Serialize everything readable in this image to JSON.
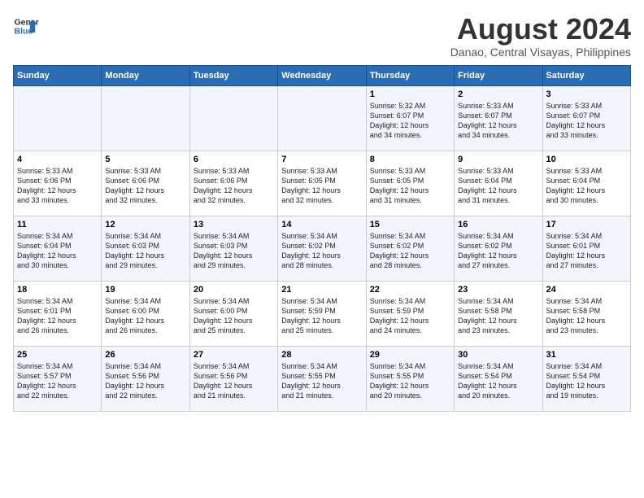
{
  "logo": {
    "text_general": "General",
    "text_blue": "Blue"
  },
  "title": "August 2024",
  "subtitle": "Danao, Central Visayas, Philippines",
  "weekdays": [
    "Sunday",
    "Monday",
    "Tuesday",
    "Wednesday",
    "Thursday",
    "Friday",
    "Saturday"
  ],
  "weeks": [
    [
      {
        "day": "",
        "info": ""
      },
      {
        "day": "",
        "info": ""
      },
      {
        "day": "",
        "info": ""
      },
      {
        "day": "",
        "info": ""
      },
      {
        "day": "1",
        "info": "Sunrise: 5:32 AM\nSunset: 6:07 PM\nDaylight: 12 hours\nand 34 minutes."
      },
      {
        "day": "2",
        "info": "Sunrise: 5:33 AM\nSunset: 6:07 PM\nDaylight: 12 hours\nand 34 minutes."
      },
      {
        "day": "3",
        "info": "Sunrise: 5:33 AM\nSunset: 6:07 PM\nDaylight: 12 hours\nand 33 minutes."
      }
    ],
    [
      {
        "day": "4",
        "info": "Sunrise: 5:33 AM\nSunset: 6:06 PM\nDaylight: 12 hours\nand 33 minutes."
      },
      {
        "day": "5",
        "info": "Sunrise: 5:33 AM\nSunset: 6:06 PM\nDaylight: 12 hours\nand 32 minutes."
      },
      {
        "day": "6",
        "info": "Sunrise: 5:33 AM\nSunset: 6:06 PM\nDaylight: 12 hours\nand 32 minutes."
      },
      {
        "day": "7",
        "info": "Sunrise: 5:33 AM\nSunset: 6:05 PM\nDaylight: 12 hours\nand 32 minutes."
      },
      {
        "day": "8",
        "info": "Sunrise: 5:33 AM\nSunset: 6:05 PM\nDaylight: 12 hours\nand 31 minutes."
      },
      {
        "day": "9",
        "info": "Sunrise: 5:33 AM\nSunset: 6:04 PM\nDaylight: 12 hours\nand 31 minutes."
      },
      {
        "day": "10",
        "info": "Sunrise: 5:33 AM\nSunset: 6:04 PM\nDaylight: 12 hours\nand 30 minutes."
      }
    ],
    [
      {
        "day": "11",
        "info": "Sunrise: 5:34 AM\nSunset: 6:04 PM\nDaylight: 12 hours\nand 30 minutes."
      },
      {
        "day": "12",
        "info": "Sunrise: 5:34 AM\nSunset: 6:03 PM\nDaylight: 12 hours\nand 29 minutes."
      },
      {
        "day": "13",
        "info": "Sunrise: 5:34 AM\nSunset: 6:03 PM\nDaylight: 12 hours\nand 29 minutes."
      },
      {
        "day": "14",
        "info": "Sunrise: 5:34 AM\nSunset: 6:02 PM\nDaylight: 12 hours\nand 28 minutes."
      },
      {
        "day": "15",
        "info": "Sunrise: 5:34 AM\nSunset: 6:02 PM\nDaylight: 12 hours\nand 28 minutes."
      },
      {
        "day": "16",
        "info": "Sunrise: 5:34 AM\nSunset: 6:02 PM\nDaylight: 12 hours\nand 27 minutes."
      },
      {
        "day": "17",
        "info": "Sunrise: 5:34 AM\nSunset: 6:01 PM\nDaylight: 12 hours\nand 27 minutes."
      }
    ],
    [
      {
        "day": "18",
        "info": "Sunrise: 5:34 AM\nSunset: 6:01 PM\nDaylight: 12 hours\nand 26 minutes."
      },
      {
        "day": "19",
        "info": "Sunrise: 5:34 AM\nSunset: 6:00 PM\nDaylight: 12 hours\nand 26 minutes."
      },
      {
        "day": "20",
        "info": "Sunrise: 5:34 AM\nSunset: 6:00 PM\nDaylight: 12 hours\nand 25 minutes."
      },
      {
        "day": "21",
        "info": "Sunrise: 5:34 AM\nSunset: 5:59 PM\nDaylight: 12 hours\nand 25 minutes."
      },
      {
        "day": "22",
        "info": "Sunrise: 5:34 AM\nSunset: 5:59 PM\nDaylight: 12 hours\nand 24 minutes."
      },
      {
        "day": "23",
        "info": "Sunrise: 5:34 AM\nSunset: 5:58 PM\nDaylight: 12 hours\nand 23 minutes."
      },
      {
        "day": "24",
        "info": "Sunrise: 5:34 AM\nSunset: 5:58 PM\nDaylight: 12 hours\nand 23 minutes."
      }
    ],
    [
      {
        "day": "25",
        "info": "Sunrise: 5:34 AM\nSunset: 5:57 PM\nDaylight: 12 hours\nand 22 minutes."
      },
      {
        "day": "26",
        "info": "Sunrise: 5:34 AM\nSunset: 5:56 PM\nDaylight: 12 hours\nand 22 minutes."
      },
      {
        "day": "27",
        "info": "Sunrise: 5:34 AM\nSunset: 5:56 PM\nDaylight: 12 hours\nand 21 minutes."
      },
      {
        "day": "28",
        "info": "Sunrise: 5:34 AM\nSunset: 5:55 PM\nDaylight: 12 hours\nand 21 minutes."
      },
      {
        "day": "29",
        "info": "Sunrise: 5:34 AM\nSunset: 5:55 PM\nDaylight: 12 hours\nand 20 minutes."
      },
      {
        "day": "30",
        "info": "Sunrise: 5:34 AM\nSunset: 5:54 PM\nDaylight: 12 hours\nand 20 minutes."
      },
      {
        "day": "31",
        "info": "Sunrise: 5:34 AM\nSunset: 5:54 PM\nDaylight: 12 hours\nand 19 minutes."
      }
    ]
  ]
}
